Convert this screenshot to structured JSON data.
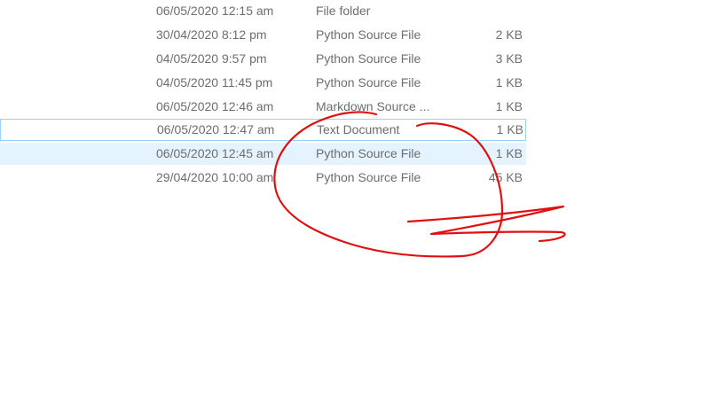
{
  "files": [
    {
      "modified": "06/05/2020 12:15 am",
      "type": "File folder",
      "size": ""
    },
    {
      "modified": "30/04/2020 8:12 pm",
      "type": "Python Source File",
      "size": "2 KB"
    },
    {
      "modified": "04/05/2020 9:57 pm",
      "type": "Python Source File",
      "size": "3 KB"
    },
    {
      "modified": "04/05/2020 11:45 pm",
      "type": "Python Source File",
      "size": "1 KB"
    },
    {
      "modified": "06/05/2020 12:46 am",
      "type": "Markdown Source ...",
      "size": "1 KB"
    },
    {
      "modified": "06/05/2020 12:47 am",
      "type": "Text Document",
      "size": "1 KB"
    },
    {
      "modified": "06/05/2020 12:45 am",
      "type": "Python Source File",
      "size": "1 KB"
    },
    {
      "modified": "29/04/2020 10:00 am",
      "type": "Python Source File",
      "size": "45 KB"
    }
  ],
  "colors": {
    "text": "#6d6d6d",
    "selection_fill": "#e5f3ff",
    "focus_border": "#99d1ff",
    "annotation_ink": "#e01010"
  }
}
